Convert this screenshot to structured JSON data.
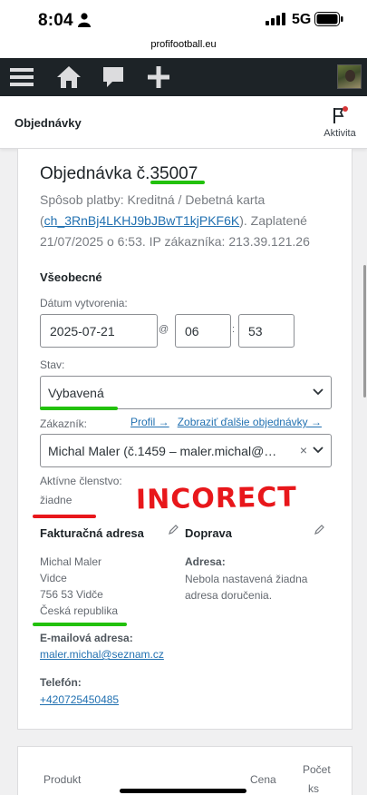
{
  "status": {
    "time": "8:04",
    "network": "5G"
  },
  "browser": {
    "url": "profifootball.eu"
  },
  "adminbar": {
    "menu_icon": "menu-icon",
    "home_icon": "home-icon",
    "comments_icon": "comment-icon",
    "new_icon": "plus-icon"
  },
  "header": {
    "title": "Objednávky",
    "activity_label": "Aktivita"
  },
  "order": {
    "title": "Objednávka č.35007",
    "payment_prefix": "Spôsob platby: Kreditná / Debetná karta",
    "txn_open": "(",
    "txn_link": "ch_3RnBj4LKHJ9bJBwT1kjPKF6K",
    "payment_suffix": "). Zaplatené 21/07/2025 o 6:53. IP zákazníka: 213.39.121.26"
  },
  "general": {
    "heading": "Všeobecné",
    "date_label": "Dátum vytvorenia:",
    "date_value": "2025-07-21",
    "at": "@",
    "hour": "06",
    "colon": ":",
    "minute": "53",
    "status_label": "Stav:",
    "status_value": "Vybavená",
    "customer_label": "Zákazník:",
    "profile_link": "Profil →",
    "other_orders_link": "Zobraziť ďalšie objednávky →",
    "customer_value": "Michal Maler (č.1459 – maler.michal@…",
    "clear": "×",
    "membership_label": "Aktívne členstvo:",
    "membership_value": "žiadne"
  },
  "billing": {
    "heading": "Fakturačná adresa",
    "lines": [
      "Michal Maler",
      "Vidce",
      "756 53 Vidče",
      "Česká republika"
    ],
    "email_label": "E-mailová adresa:",
    "email": "maler.michal@seznam.cz",
    "phone_label": "Telefón:",
    "phone": "+420725450485"
  },
  "shipping": {
    "heading": "Doprava",
    "address_label": "Adresa:",
    "address_text": "Nebola nastavená žiadna adresa doručenia."
  },
  "annotation": {
    "text": "INCORECT"
  },
  "items_table": {
    "col_product": "Produkt",
    "col_price": "Cena",
    "col_qty_1": "Počet",
    "col_qty_2": "ks"
  },
  "colors": {
    "accent": "#2271b1",
    "adminbar": "#1d2327",
    "mark_green": "#22c10b",
    "mark_red": "#e8171b"
  }
}
